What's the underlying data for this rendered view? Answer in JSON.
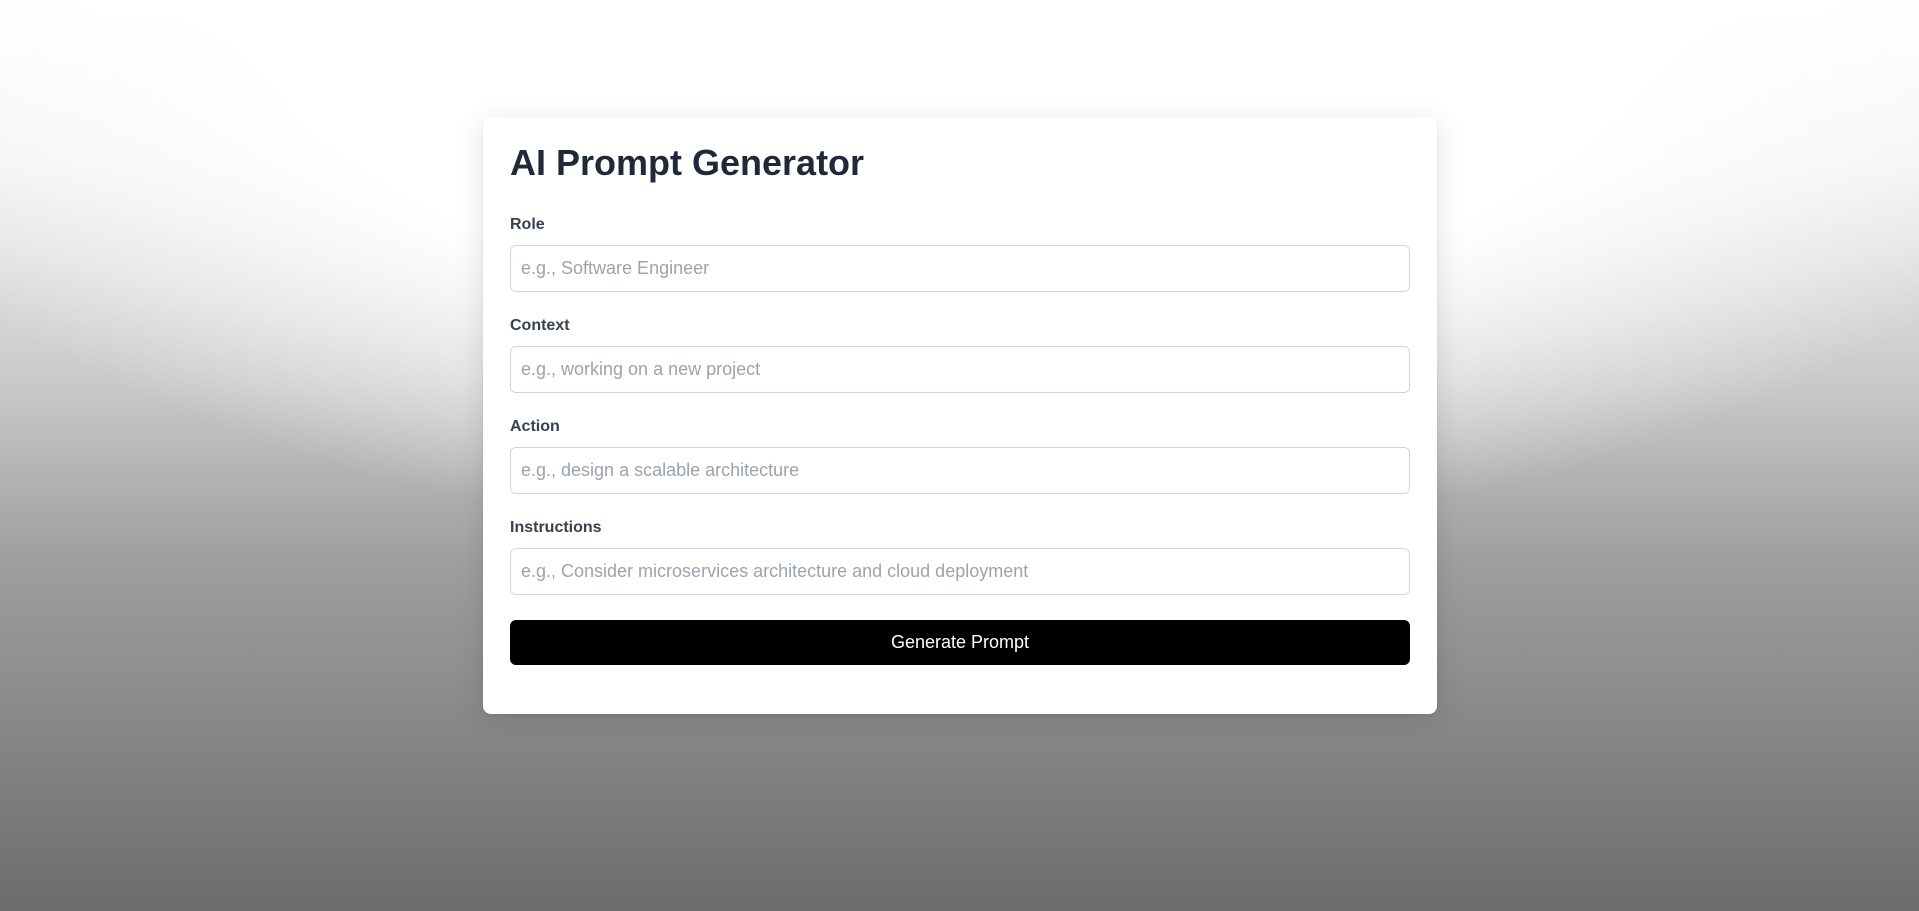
{
  "form": {
    "title": "AI Prompt Generator",
    "fields": [
      {
        "label": "Role",
        "value": "",
        "placeholder": "e.g., Software Engineer"
      },
      {
        "label": "Context",
        "value": "",
        "placeholder": "e.g., working on a new project"
      },
      {
        "label": "Action",
        "value": "",
        "placeholder": "e.g., design a scalable architecture"
      },
      {
        "label": "Instructions",
        "value": "",
        "placeholder": "e.g., Consider microservices architecture and cloud deployment"
      }
    ],
    "submit_label": "Generate Prompt"
  },
  "colors": {
    "button_background": "#000000",
    "button_text": "#ffffff",
    "title_text": "#1f2937",
    "placeholder_text": "#9ca3af",
    "input_border": "#d1d5db"
  }
}
